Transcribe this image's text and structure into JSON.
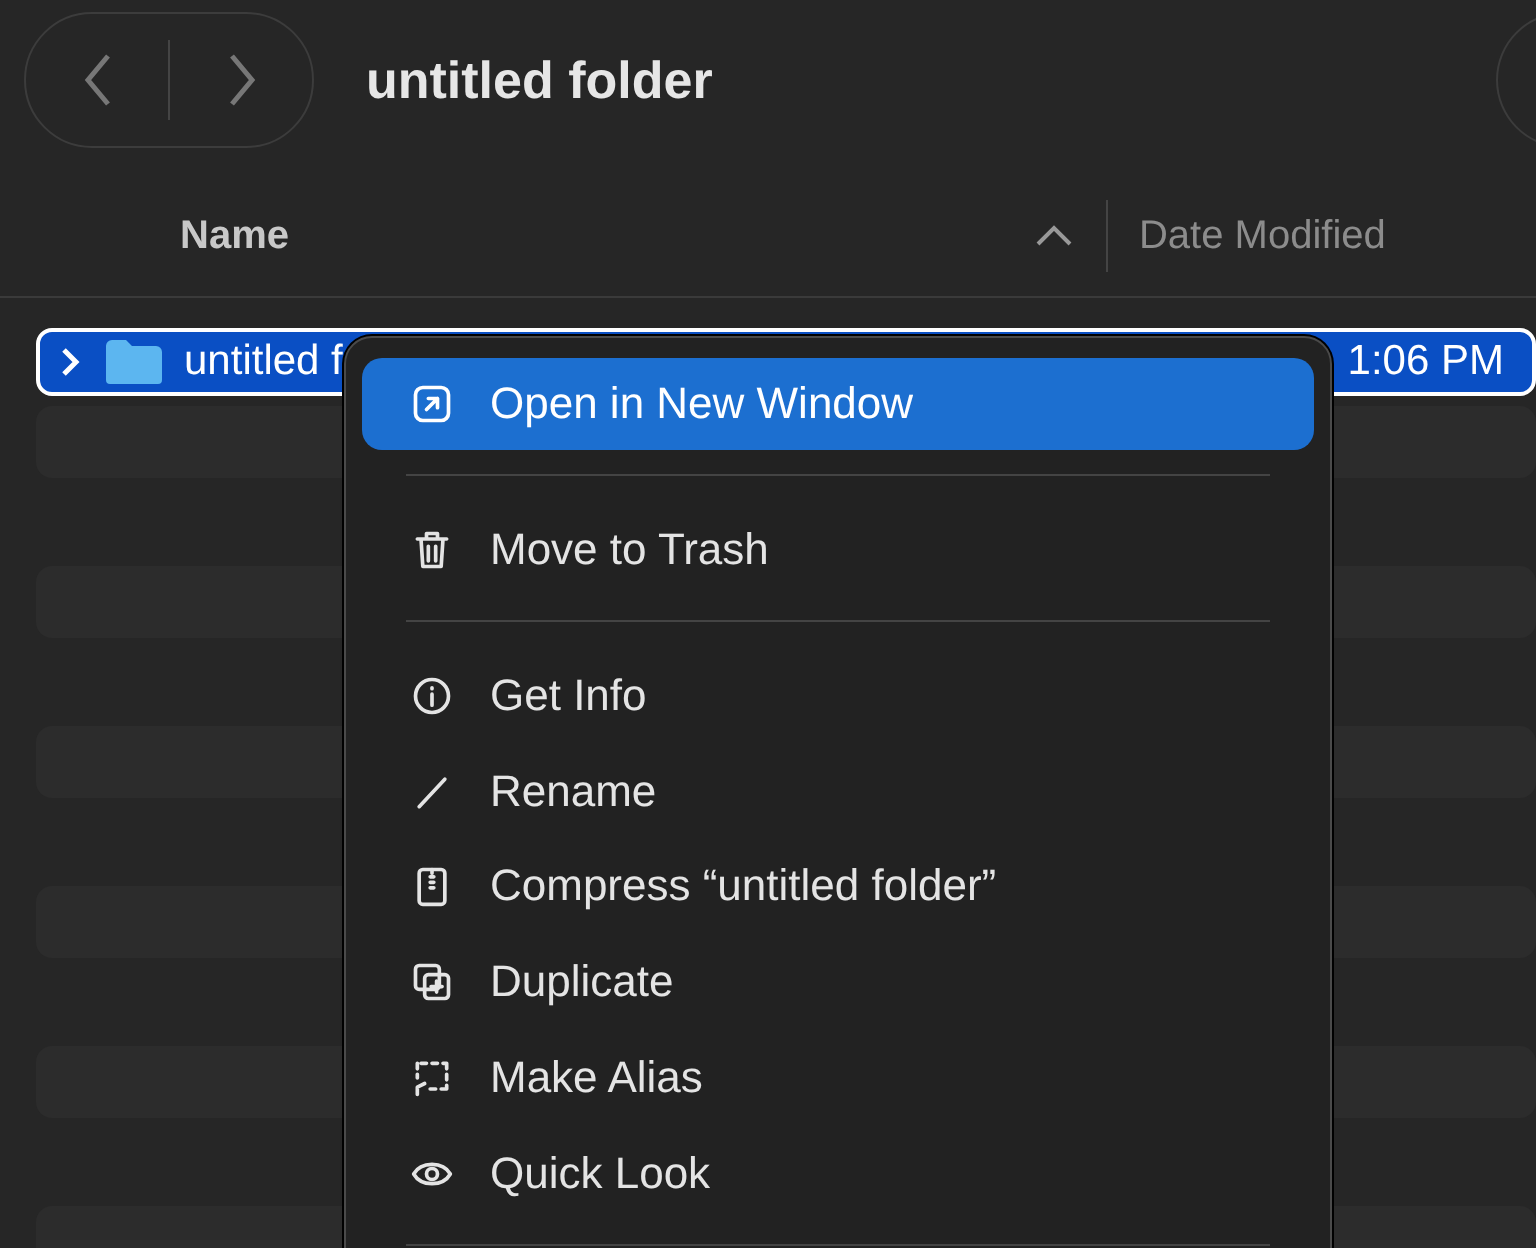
{
  "window": {
    "title": "untitled folder"
  },
  "columns": [
    {
      "label": "Name",
      "sorted": true
    },
    {
      "label": "Date Modified",
      "sorted": false
    }
  ],
  "rows": [
    {
      "name": "untitled f",
      "date": "1:06 PM",
      "selected": true
    }
  ],
  "context_menu": [
    {
      "kind": "item",
      "label": "Open in New Window",
      "selected": true
    },
    {
      "kind": "separator"
    },
    {
      "kind": "item",
      "label": "Move to Trash",
      "selected": false
    },
    {
      "kind": "separator"
    },
    {
      "kind": "item",
      "label": "Get Info",
      "selected": false
    },
    {
      "kind": "item",
      "label": "Rename",
      "selected": false
    },
    {
      "kind": "item",
      "label": "Compress “untitled folder”",
      "selected": false
    },
    {
      "kind": "item",
      "label": "Duplicate",
      "selected": false
    },
    {
      "kind": "item",
      "label": "Make Alias",
      "selected": false
    },
    {
      "kind": "item",
      "label": "Quick Look",
      "selected": false
    },
    {
      "kind": "separator"
    }
  ]
}
